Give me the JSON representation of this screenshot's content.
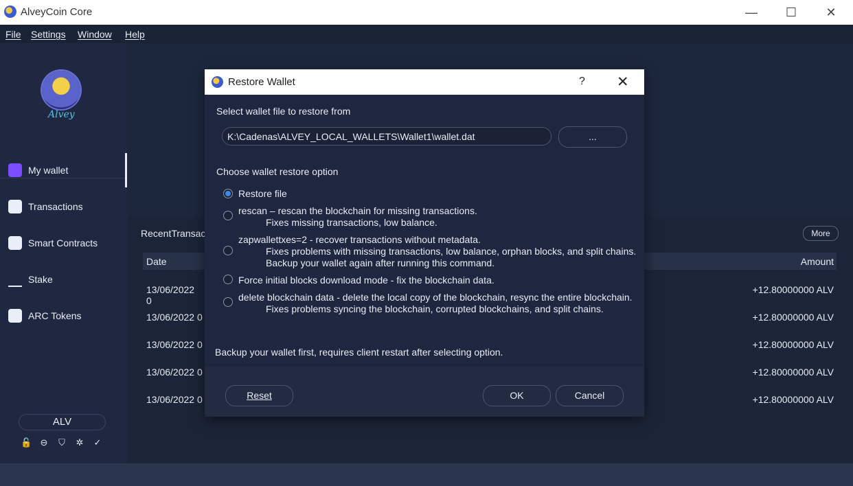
{
  "window": {
    "title": "AlveyCoin Core",
    "minimize_glyph": "—",
    "maximize_glyph": "☐",
    "close_glyph": "✕"
  },
  "menubar": {
    "items": [
      "File",
      "Settings",
      "Window",
      "Help"
    ]
  },
  "sidebar": {
    "logo_text": "Alvey",
    "items": [
      {
        "label": "My wallet",
        "icon": "wallet-icon"
      },
      {
        "label": "Transactions",
        "icon": "list-icon"
      },
      {
        "label": "Smart Contracts",
        "icon": "contract-icon"
      },
      {
        "label": "Stake",
        "icon": "stake-icon"
      },
      {
        "label": "ARC Tokens",
        "icon": "token-icon"
      }
    ],
    "unit_selector": "ALV",
    "status_icons": [
      "lock-icon",
      "minus-circle-icon",
      "shield-icon",
      "network-icon",
      "check-icon"
    ],
    "status_glyphs": [
      "🔓",
      "⊖",
      "⛉",
      "✲",
      "✓"
    ]
  },
  "main": {
    "recent_title": "RecentTransact",
    "more_label": "More",
    "columns": {
      "date": "Date",
      "amount": "Amount"
    },
    "rows": [
      {
        "date": "13/06/2022 0",
        "amount": "+12.80000000 ALV"
      },
      {
        "date": "13/06/2022 0",
        "amount": "+12.80000000 ALV"
      },
      {
        "date": "13/06/2022 0",
        "amount": "+12.80000000 ALV"
      },
      {
        "date": "13/06/2022 0",
        "amount": "+12.80000000 ALV"
      },
      {
        "date": "13/06/2022 0",
        "amount": "+12.80000000 ALV"
      }
    ]
  },
  "dialog": {
    "title": "Restore Wallet",
    "help_glyph": "?",
    "close_glyph": "✕",
    "select_label": "Select wallet file to restore from",
    "path_value": "K:\\Cadenas\\ALVEY_LOCAL_WALLETS\\Wallet1\\wallet.dat",
    "browse_label": "...",
    "choose_label": "Choose wallet restore option",
    "options": [
      {
        "title": "Restore file",
        "desc": [],
        "checked": true
      },
      {
        "title": "rescan – rescan the blockchain for missing transactions.",
        "desc": [
          "Fixes missing transactions, low balance."
        ],
        "checked": false
      },
      {
        "title": "zapwallettxes=2 - recover transactions without metadata.",
        "desc": [
          "Fixes problems with missing transactions, low balance, orphan blocks, and split chains.",
          "Backup your wallet again after running this command."
        ],
        "checked": false
      },
      {
        "title": "Force initial blocks download mode - fix the blockchain data.",
        "desc": [],
        "checked": false
      },
      {
        "title": "delete blockchain data - delete the local copy of the blockchain, resync the entire blockchain.",
        "desc": [
          "Fixes problems syncing the blockchain, corrupted blockchains, and split chains."
        ],
        "checked": false
      }
    ],
    "note": "Backup your wallet first, requires client restart after selecting option.",
    "reset_label": "Reset",
    "ok_label": "OK",
    "cancel_label": "Cancel"
  }
}
